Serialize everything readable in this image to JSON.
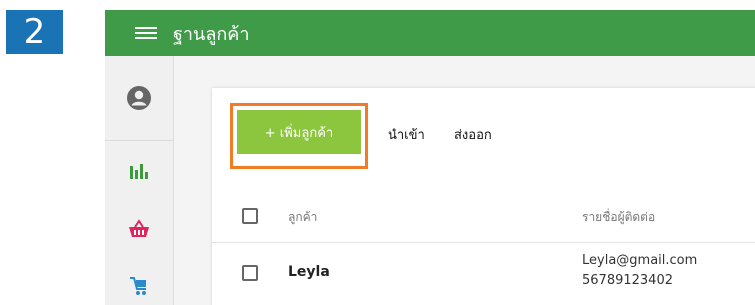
{
  "step_number": "2",
  "header": {
    "title": "ฐานลูกค้า",
    "menu_icon": "hamburger-icon"
  },
  "sidebar": {
    "items": [
      {
        "icon": "user-profile-icon"
      },
      {
        "icon": "bar-chart-icon"
      },
      {
        "icon": "basket-icon"
      },
      {
        "icon": "cart-icon"
      }
    ]
  },
  "toolbar": {
    "add_customer_label": "+ เพิ่มลูกค้า",
    "import_label": "นำเข้า",
    "export_label": "ส่งออก"
  },
  "table": {
    "columns": [
      "ลูกค้า",
      "รายชื่อผู้ติดต่อ"
    ],
    "rows": [
      {
        "name": "Leyla",
        "email": "Leyla@gmail.com",
        "phone": "56789123402"
      }
    ]
  },
  "colors": {
    "header_bg": "#3f9b47",
    "add_button_bg": "#8cc63f",
    "highlight_border": "#f07c24",
    "step_badge_bg": "#1a73b5"
  }
}
